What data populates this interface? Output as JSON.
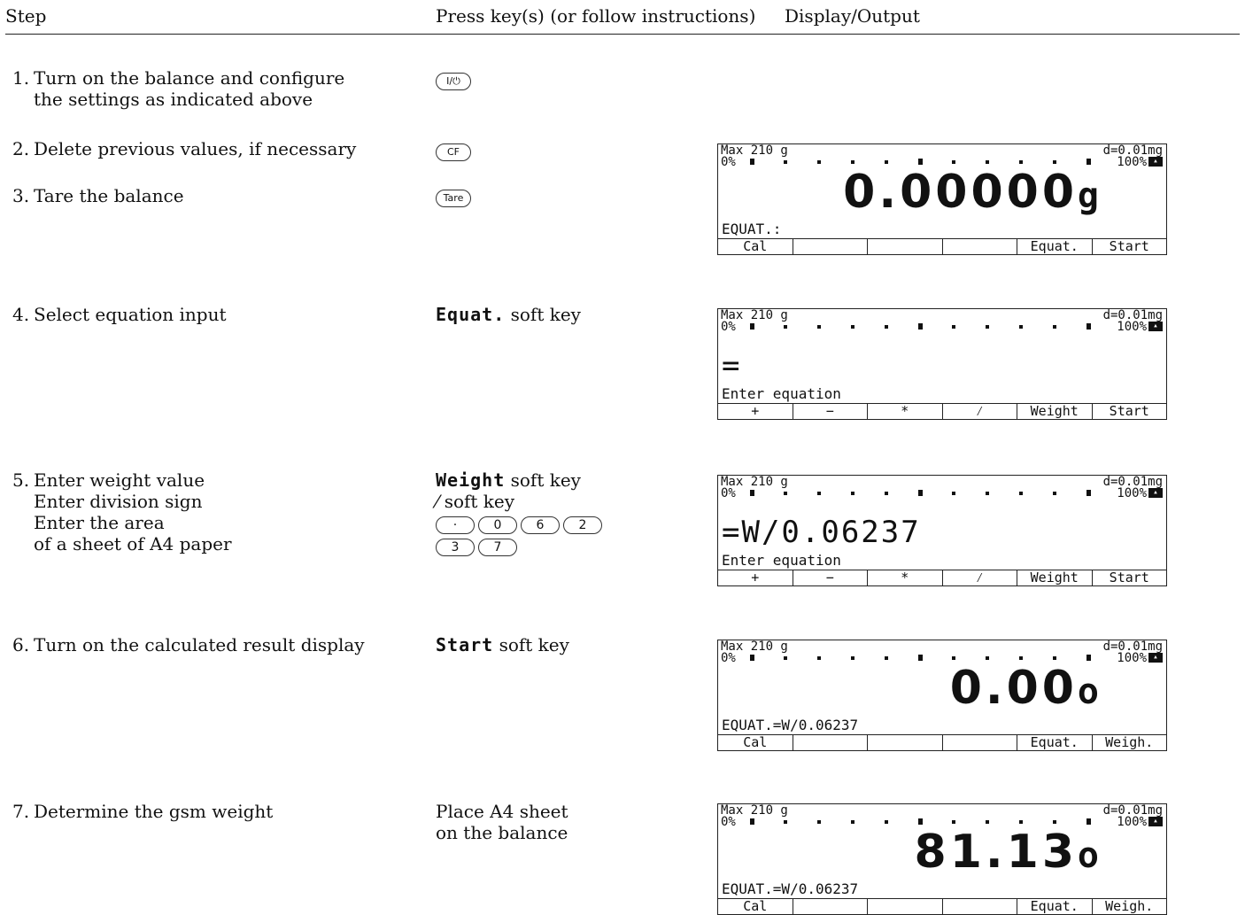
{
  "header": {
    "step": "Step",
    "press": "Press key(s) (or follow instructions)",
    "display": "Display/Output"
  },
  "steps": [
    {
      "num": "1.",
      "lines": [
        "Turn on the balance and configure",
        "the settings as indicated above"
      ]
    },
    {
      "num": "2.",
      "lines": [
        "Delete previous values, if necessary"
      ]
    },
    {
      "num": "3.",
      "lines": [
        "Tare the balance"
      ]
    },
    {
      "num": "4.",
      "lines": [
        "Select equation input"
      ]
    },
    {
      "num": "5.",
      "lines": [
        "Enter weight value",
        "Enter division sign",
        "Enter the area",
        "of a sheet of A4 paper"
      ]
    },
    {
      "num": "6.",
      "lines": [
        "Turn on the calculated result display"
      ]
    },
    {
      "num": "7.",
      "lines": [
        "Determine the gsm weight"
      ]
    }
  ],
  "keys": {
    "k1": "I/⏻",
    "k2": "CF",
    "k3": "Tare",
    "k4_soft": "Equat.",
    "k4_text": "soft key",
    "k5_soft": "Weight",
    "k5_text": "soft key",
    "k5_div": "⁄",
    "k5_div_text": "soft key",
    "k5_digits1": [
      "·",
      "0",
      "6",
      "2"
    ],
    "k5_digits2": [
      "3",
      "7"
    ],
    "k6_soft": "Start",
    "k6_text": "soft key",
    "k7_line1": "Place A4 sheet",
    "k7_line2": "on the balance"
  },
  "displays": [
    {
      "max": "Max 210 g",
      "pct0": "0%",
      "d": "d=0.01mg",
      "pct100": "100%",
      "big": "0.00000",
      "unit": "g",
      "mid": "",
      "bottom": "EQUAT.:",
      "soft": [
        "Cal",
        "",
        "",
        "",
        "Equat.",
        "Start"
      ]
    },
    {
      "max": "Max 210 g",
      "pct0": "0%",
      "d": "d=0.01mg",
      "pct100": "100%",
      "big": "",
      "unit": "",
      "mid": "=",
      "bottom": "Enter equation",
      "soft": [
        "+",
        "−",
        "*",
        "⁄",
        "Weight",
        "Start"
      ]
    },
    {
      "max": "Max 210 g",
      "pct0": "0%",
      "d": "d=0.01mg",
      "pct100": "100%",
      "big": "",
      "unit": "",
      "mid": "=W/0.06237",
      "bottom": "Enter equation",
      "soft": [
        "+",
        "−",
        "*",
        "⁄",
        "Weight",
        "Start"
      ]
    },
    {
      "max": "Max 210 g",
      "pct0": "0%",
      "d": "d=0.01mg",
      "pct100": "100%",
      "big": "0.00",
      "unit": "o",
      "mid": "",
      "bottom": "EQUAT.=W/0.06237",
      "soft": [
        "Cal",
        "",
        "",
        "",
        "Equat.",
        "Weigh."
      ]
    },
    {
      "max": "Max 210 g",
      "pct0": "0%",
      "d": "d=0.01mg",
      "pct100": "100%",
      "big": "81.13",
      "unit": "o",
      "mid": "",
      "bottom": "EQUAT.=W/0.06237",
      "soft": [
        "Cal",
        "",
        "",
        "",
        "Equat.",
        "Weigh."
      ]
    }
  ]
}
